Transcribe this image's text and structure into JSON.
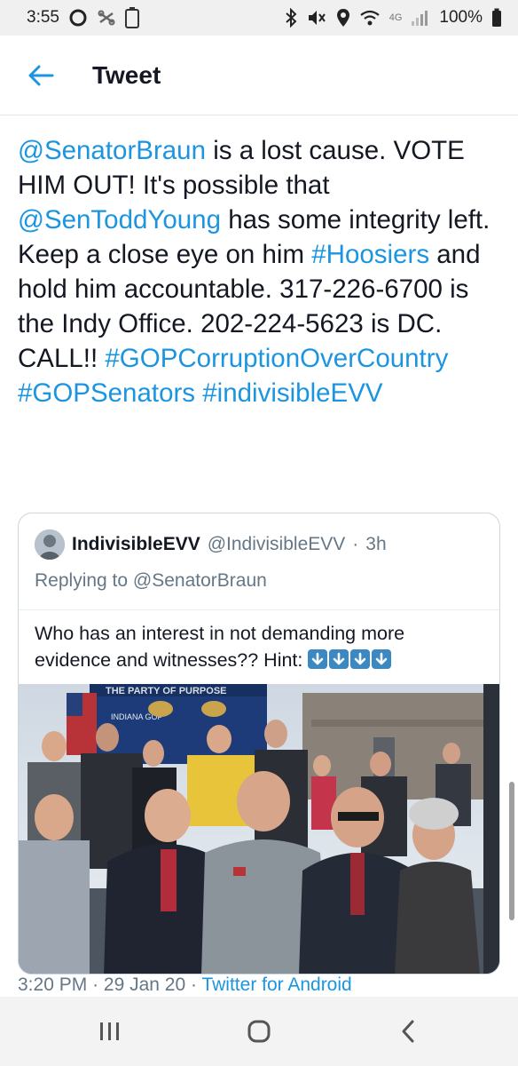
{
  "status_bar": {
    "time": "3:55",
    "battery_label": "100",
    "network": "4G",
    "battery_pct": "100%"
  },
  "header": {
    "title": "Tweet"
  },
  "tweet": {
    "segments": [
      {
        "text": "@SenatorBraun",
        "type": "link"
      },
      {
        "text": " is a lost cause. VOTE HIM OUT! It's possible that ",
        "type": "text"
      },
      {
        "text": "@SenToddYoung",
        "type": "link"
      },
      {
        "text": " has some integ­rity left. Keep a close eye on him ",
        "type": "text"
      },
      {
        "text": "#Hoosiers",
        "type": "link"
      },
      {
        "text": " and hold him account­able. 317-226-6700 is the Indy Office. 202-224-5623 is DC. CALL!! ",
        "type": "text"
      },
      {
        "text": "#GOPCorruptionOverCountry",
        "type": "link"
      },
      {
        "text": " ",
        "type": "text"
      },
      {
        "text": "#GOPSenators",
        "type": "link"
      },
      {
        "text": " ",
        "type": "text"
      },
      {
        "text": "#indivisibleEVV",
        "type": "link"
      }
    ],
    "timestamp": "3:20 PM",
    "date": "29 Jan 20",
    "separator": "·",
    "source": "Twitter for Android"
  },
  "quote": {
    "name": "IndivisibleEVV",
    "handle": "@IndivisibleEVV",
    "dot": "·",
    "time": "3h",
    "replying_prefix": "Replying to ",
    "replying_to": "@SenatorBraun",
    "text": "Who has an interest in not demanding more evidence and witnesses?? Hint: ",
    "emoji_count": 4,
    "photo_banner": "THE PARTY OF PURPOSE",
    "photo_sign": "INDIANA GOP"
  },
  "colors": {
    "link": "#1b95e0",
    "secondary": "#657786",
    "border": "#ccd6dd"
  }
}
